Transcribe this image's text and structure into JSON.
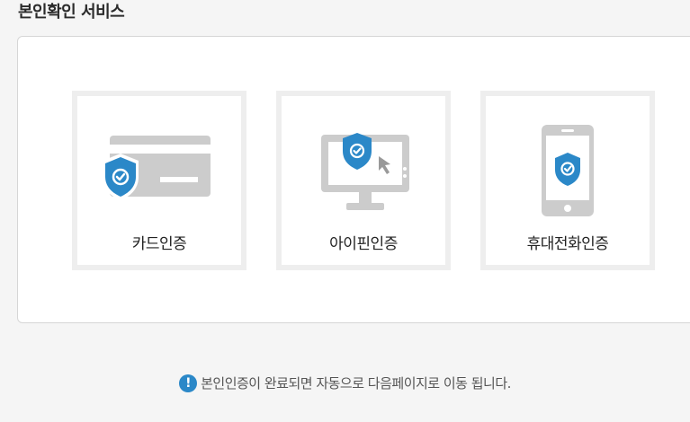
{
  "page": {
    "title": "본인확인 서비스"
  },
  "options": [
    {
      "label": "카드인증",
      "icon": "credit-card-shield-icon"
    },
    {
      "label": "아이핀인증",
      "icon": "monitor-shield-icon"
    },
    {
      "label": "휴대전화인증",
      "icon": "smartphone-shield-icon"
    }
  ],
  "notice": {
    "icon": "exclamation-icon",
    "text": "본인인증이 완료되면 자동으로 다음페이지로 이동 됩니다."
  },
  "colors": {
    "accent": "#2b88c8",
    "icon_gray": "#cccccc",
    "card_border": "#eeeeee"
  }
}
